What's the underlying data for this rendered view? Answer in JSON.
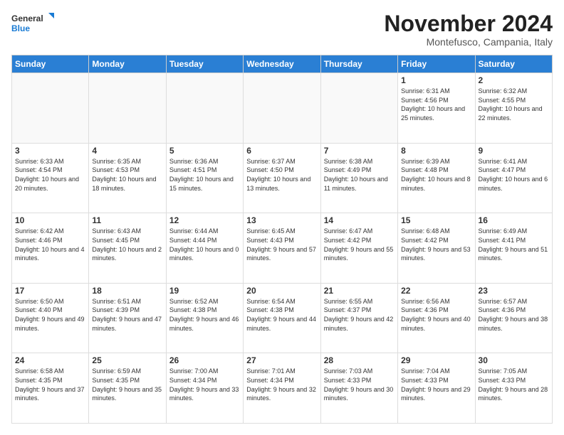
{
  "logo": {
    "text_general": "General",
    "text_blue": "Blue"
  },
  "title": "November 2024",
  "subtitle": "Montefusco, Campania, Italy",
  "days_of_week": [
    "Sunday",
    "Monday",
    "Tuesday",
    "Wednesday",
    "Thursday",
    "Friday",
    "Saturday"
  ],
  "weeks": [
    [
      {
        "day": "",
        "info": ""
      },
      {
        "day": "",
        "info": ""
      },
      {
        "day": "",
        "info": ""
      },
      {
        "day": "",
        "info": ""
      },
      {
        "day": "",
        "info": ""
      },
      {
        "day": "1",
        "info": "Sunrise: 6:31 AM\nSunset: 4:56 PM\nDaylight: 10 hours and 25 minutes."
      },
      {
        "day": "2",
        "info": "Sunrise: 6:32 AM\nSunset: 4:55 PM\nDaylight: 10 hours and 22 minutes."
      }
    ],
    [
      {
        "day": "3",
        "info": "Sunrise: 6:33 AM\nSunset: 4:54 PM\nDaylight: 10 hours and 20 minutes."
      },
      {
        "day": "4",
        "info": "Sunrise: 6:35 AM\nSunset: 4:53 PM\nDaylight: 10 hours and 18 minutes."
      },
      {
        "day": "5",
        "info": "Sunrise: 6:36 AM\nSunset: 4:51 PM\nDaylight: 10 hours and 15 minutes."
      },
      {
        "day": "6",
        "info": "Sunrise: 6:37 AM\nSunset: 4:50 PM\nDaylight: 10 hours and 13 minutes."
      },
      {
        "day": "7",
        "info": "Sunrise: 6:38 AM\nSunset: 4:49 PM\nDaylight: 10 hours and 11 minutes."
      },
      {
        "day": "8",
        "info": "Sunrise: 6:39 AM\nSunset: 4:48 PM\nDaylight: 10 hours and 8 minutes."
      },
      {
        "day": "9",
        "info": "Sunrise: 6:41 AM\nSunset: 4:47 PM\nDaylight: 10 hours and 6 minutes."
      }
    ],
    [
      {
        "day": "10",
        "info": "Sunrise: 6:42 AM\nSunset: 4:46 PM\nDaylight: 10 hours and 4 minutes."
      },
      {
        "day": "11",
        "info": "Sunrise: 6:43 AM\nSunset: 4:45 PM\nDaylight: 10 hours and 2 minutes."
      },
      {
        "day": "12",
        "info": "Sunrise: 6:44 AM\nSunset: 4:44 PM\nDaylight: 10 hours and 0 minutes."
      },
      {
        "day": "13",
        "info": "Sunrise: 6:45 AM\nSunset: 4:43 PM\nDaylight: 9 hours and 57 minutes."
      },
      {
        "day": "14",
        "info": "Sunrise: 6:47 AM\nSunset: 4:42 PM\nDaylight: 9 hours and 55 minutes."
      },
      {
        "day": "15",
        "info": "Sunrise: 6:48 AM\nSunset: 4:42 PM\nDaylight: 9 hours and 53 minutes."
      },
      {
        "day": "16",
        "info": "Sunrise: 6:49 AM\nSunset: 4:41 PM\nDaylight: 9 hours and 51 minutes."
      }
    ],
    [
      {
        "day": "17",
        "info": "Sunrise: 6:50 AM\nSunset: 4:40 PM\nDaylight: 9 hours and 49 minutes."
      },
      {
        "day": "18",
        "info": "Sunrise: 6:51 AM\nSunset: 4:39 PM\nDaylight: 9 hours and 47 minutes."
      },
      {
        "day": "19",
        "info": "Sunrise: 6:52 AM\nSunset: 4:38 PM\nDaylight: 9 hours and 46 minutes."
      },
      {
        "day": "20",
        "info": "Sunrise: 6:54 AM\nSunset: 4:38 PM\nDaylight: 9 hours and 44 minutes."
      },
      {
        "day": "21",
        "info": "Sunrise: 6:55 AM\nSunset: 4:37 PM\nDaylight: 9 hours and 42 minutes."
      },
      {
        "day": "22",
        "info": "Sunrise: 6:56 AM\nSunset: 4:36 PM\nDaylight: 9 hours and 40 minutes."
      },
      {
        "day": "23",
        "info": "Sunrise: 6:57 AM\nSunset: 4:36 PM\nDaylight: 9 hours and 38 minutes."
      }
    ],
    [
      {
        "day": "24",
        "info": "Sunrise: 6:58 AM\nSunset: 4:35 PM\nDaylight: 9 hours and 37 minutes."
      },
      {
        "day": "25",
        "info": "Sunrise: 6:59 AM\nSunset: 4:35 PM\nDaylight: 9 hours and 35 minutes."
      },
      {
        "day": "26",
        "info": "Sunrise: 7:00 AM\nSunset: 4:34 PM\nDaylight: 9 hours and 33 minutes."
      },
      {
        "day": "27",
        "info": "Sunrise: 7:01 AM\nSunset: 4:34 PM\nDaylight: 9 hours and 32 minutes."
      },
      {
        "day": "28",
        "info": "Sunrise: 7:03 AM\nSunset: 4:33 PM\nDaylight: 9 hours and 30 minutes."
      },
      {
        "day": "29",
        "info": "Sunrise: 7:04 AM\nSunset: 4:33 PM\nDaylight: 9 hours and 29 minutes."
      },
      {
        "day": "30",
        "info": "Sunrise: 7:05 AM\nSunset: 4:33 PM\nDaylight: 9 hours and 28 minutes."
      }
    ]
  ]
}
